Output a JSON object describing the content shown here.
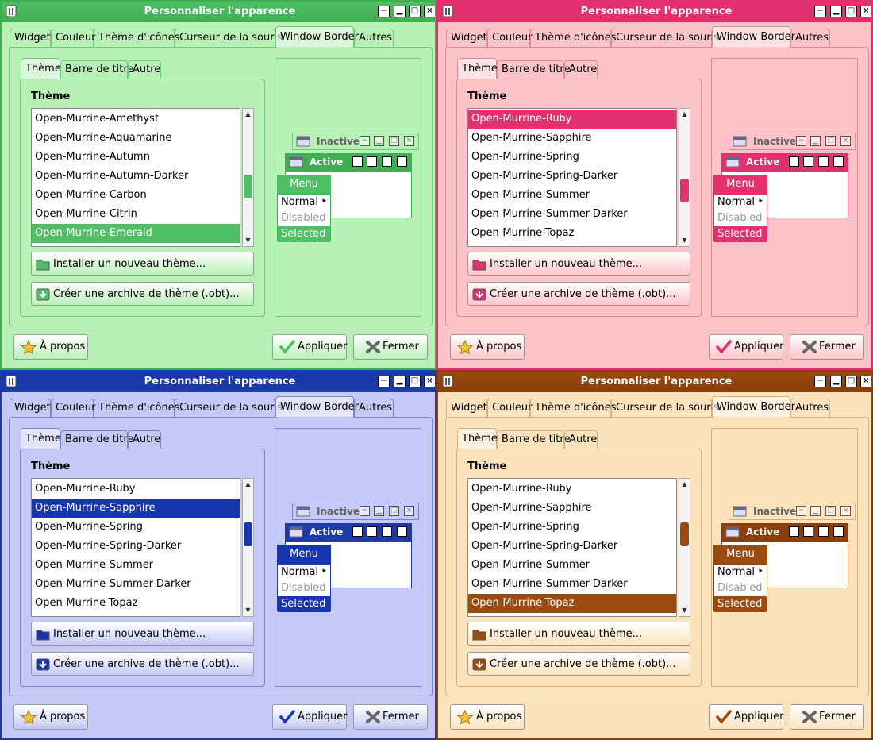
{
  "window_title": "Personnaliser l'apparence",
  "tabs": [
    "Widget",
    "Couleur",
    "Thème d'icônes",
    "Curseur de la souris",
    "Window Border",
    "Autres"
  ],
  "sub_tabs": [
    "Thème",
    "Barre de titre",
    "Autre"
  ],
  "theme_label": "Thème",
  "install_button": "Installer un nouveau thème...",
  "archive_button": "Créer une archive de thème (.obt)...",
  "about_button": "À propos",
  "apply_button": "Appliquer",
  "close_button": "Fermer",
  "preview": {
    "inactive_title": "Inactive",
    "active_title": "Active",
    "menu_title": "Menu",
    "menu_items": [
      "Normal",
      "Disabled",
      "Selected"
    ]
  },
  "panels": [
    {
      "theme_color": "Emerald",
      "colors": {
        "bg": "#b8f0b6",
        "titlebar": "#3fae52",
        "accent": "#4fbf66",
        "border": "#6ccb7c"
      },
      "list_items": [
        "Open-Murrine-Amethyst",
        "Open-Murrine-Aquamarine",
        "Open-Murrine-Autumn",
        "Open-Murrine-Autumn-Darker",
        "Open-Murrine-Carbon",
        "Open-Murrine-Citrin",
        "Open-Murrine-Emerald"
      ],
      "selected_index": 6
    },
    {
      "theme_color": "Ruby",
      "colors": {
        "bg": "#fcc4c8",
        "titlebar": "#e2306f",
        "accent": "#e3306f",
        "border": "#e28a9a"
      },
      "list_items": [
        "Open-Murrine-Ruby",
        "Open-Murrine-Sapphire",
        "Open-Murrine-Spring",
        "Open-Murrine-Spring-Darker",
        "Open-Murrine-Summer",
        "Open-Murrine-Summer-Darker",
        "Open-Murrine-Topaz"
      ],
      "selected_index": 0
    },
    {
      "theme_color": "Sapphire",
      "colors": {
        "bg": "#c6c8f6",
        "titlebar": "#1d3aa6",
        "accent": "#1835b0",
        "border": "#7c86c6"
      },
      "list_items": [
        "Open-Murrine-Ruby",
        "Open-Murrine-Sapphire",
        "Open-Murrine-Spring",
        "Open-Murrine-Spring-Darker",
        "Open-Murrine-Summer",
        "Open-Murrine-Summer-Darker",
        "Open-Murrine-Topaz"
      ],
      "selected_index": 1
    },
    {
      "theme_color": "Topaz",
      "colors": {
        "bg": "#fbe3bd",
        "titlebar": "#8b3e0a",
        "accent": "#9b4a10",
        "border": "#d8b080"
      },
      "list_items": [
        "Open-Murrine-Ruby",
        "Open-Murrine-Sapphire",
        "Open-Murrine-Spring",
        "Open-Murrine-Spring-Darker",
        "Open-Murrine-Summer",
        "Open-Murrine-Summer-Darker",
        "Open-Murrine-Topaz"
      ],
      "selected_index": 6
    }
  ]
}
